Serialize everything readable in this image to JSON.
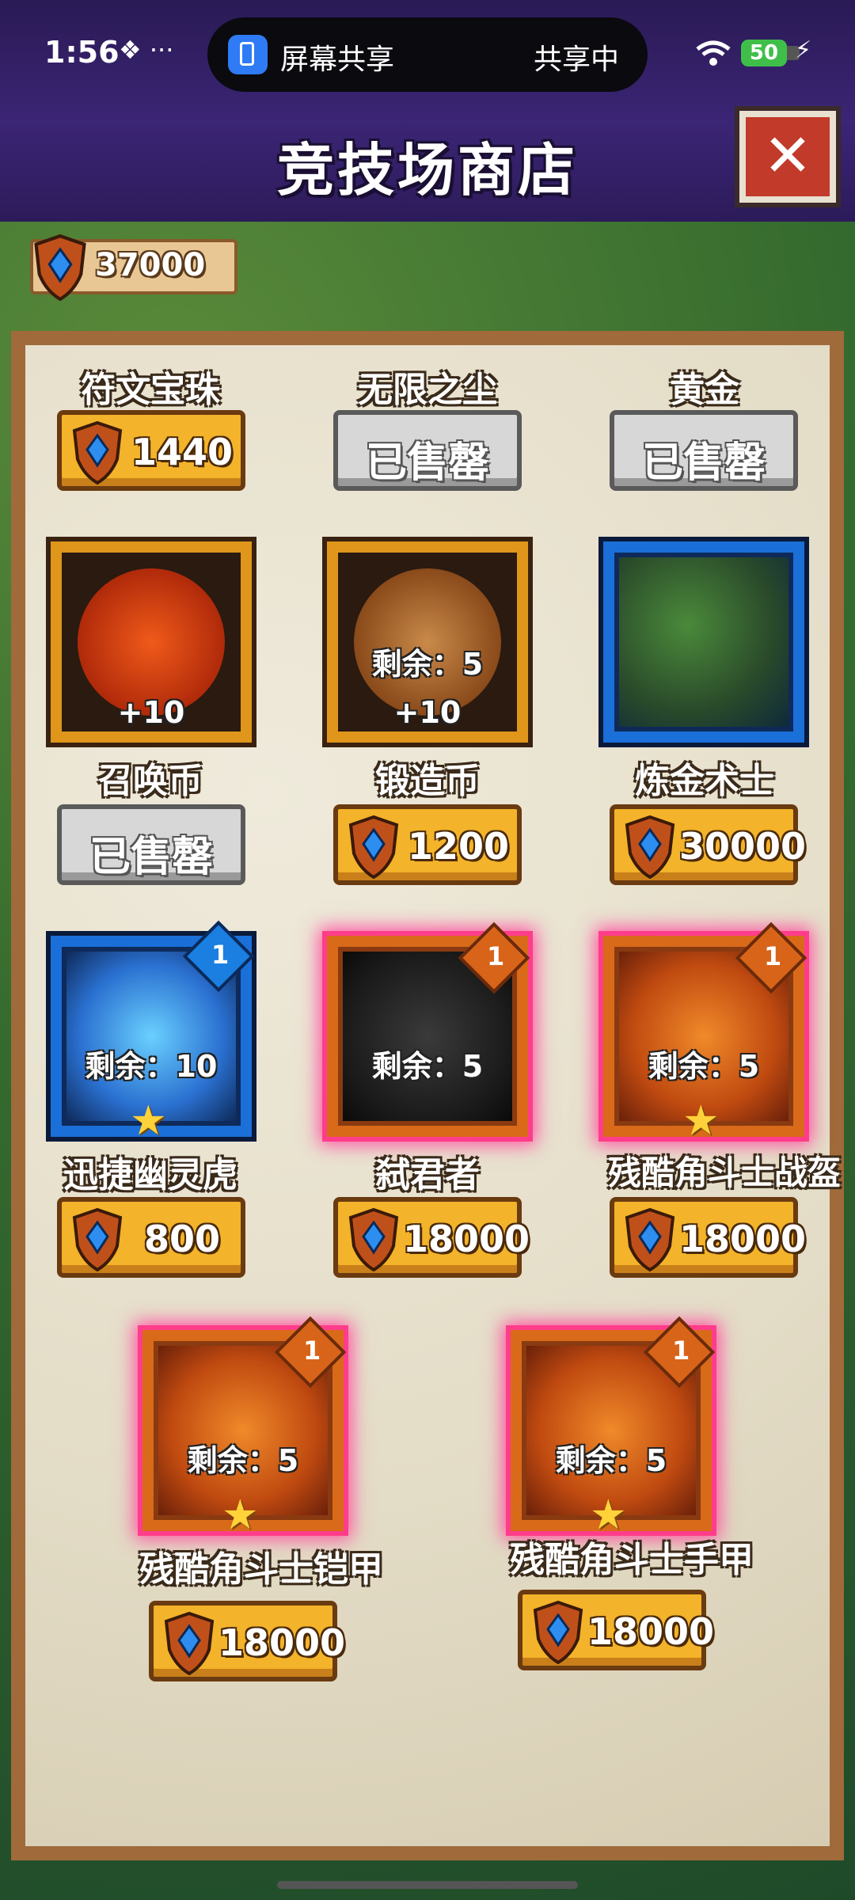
{
  "status_bar": {
    "time": "1:56",
    "left_icons": "❖ ···",
    "share_label": "屏幕共享",
    "share_status": "共享中",
    "battery": "50"
  },
  "header": {
    "title": "竞技场商店",
    "close_icon": "close-icon"
  },
  "currency": {
    "value": "37000",
    "icon": "shield-gem-icon"
  },
  "sold_out_label": "已售罄",
  "items": [
    {
      "name": "符文宝珠",
      "price": "1440"
    },
    {
      "name": "无限之尘",
      "price": null,
      "sold_out": true
    },
    {
      "name": "黄金",
      "price": null,
      "sold_out": true
    },
    {
      "name": "召唤币",
      "price": null,
      "sold_out": true,
      "bonus": "+10"
    },
    {
      "name": "锻造币",
      "price": "1200",
      "bonus": "+10",
      "remaining": "剩余：5"
    },
    {
      "name": "炼金术士",
      "price": "30000"
    },
    {
      "name": "迅捷幽灵虎",
      "price": "800",
      "remaining": "剩余：10",
      "badge": "1"
    },
    {
      "name": "弑君者",
      "price": "18000",
      "remaining": "剩余：5",
      "badge": "1"
    },
    {
      "name": "残酷角斗士战盔",
      "price": "18000",
      "remaining": "剩余：5",
      "badge": "1"
    },
    {
      "name": "残酷角斗士铠甲",
      "price": "18000",
      "remaining": "剩余：5",
      "badge": "1"
    },
    {
      "name": "残酷角斗士手甲",
      "price": "18000",
      "remaining": "剩余：5",
      "badge": "1"
    }
  ],
  "colors": {
    "price_gold": "#f3b32a",
    "sold_gray": "#d7d7d7",
    "header_purple": "#3b2575",
    "glow_pink": "#ff4fa0"
  }
}
